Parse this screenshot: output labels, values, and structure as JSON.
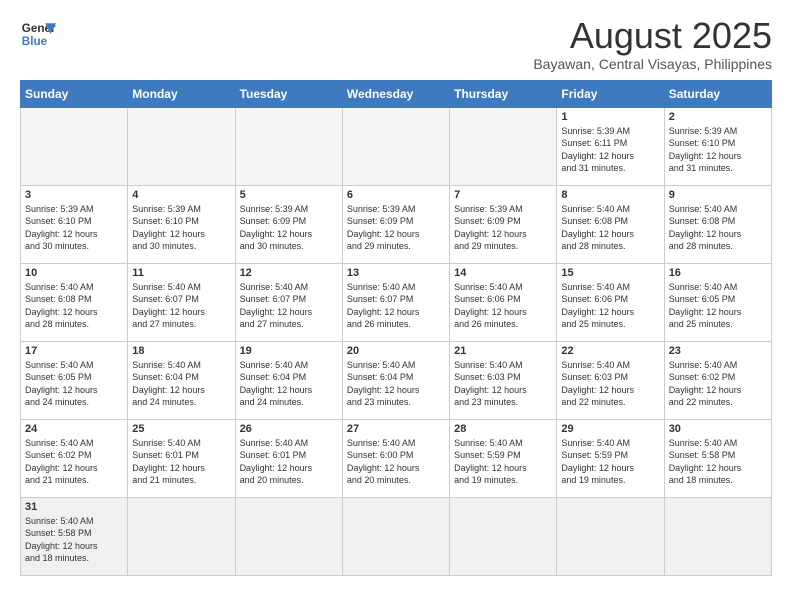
{
  "header": {
    "logo_general": "General",
    "logo_blue": "Blue",
    "title": "August 2025",
    "subtitle": "Bayawan, Central Visayas, Philippines"
  },
  "weekdays": [
    "Sunday",
    "Monday",
    "Tuesday",
    "Wednesday",
    "Thursday",
    "Friday",
    "Saturday"
  ],
  "weeks": [
    [
      {
        "day": "",
        "info": ""
      },
      {
        "day": "",
        "info": ""
      },
      {
        "day": "",
        "info": ""
      },
      {
        "day": "",
        "info": ""
      },
      {
        "day": "",
        "info": ""
      },
      {
        "day": "1",
        "info": "Sunrise: 5:39 AM\nSunset: 6:11 PM\nDaylight: 12 hours\nand 31 minutes."
      },
      {
        "day": "2",
        "info": "Sunrise: 5:39 AM\nSunset: 6:10 PM\nDaylight: 12 hours\nand 31 minutes."
      }
    ],
    [
      {
        "day": "3",
        "info": "Sunrise: 5:39 AM\nSunset: 6:10 PM\nDaylight: 12 hours\nand 30 minutes."
      },
      {
        "day": "4",
        "info": "Sunrise: 5:39 AM\nSunset: 6:10 PM\nDaylight: 12 hours\nand 30 minutes."
      },
      {
        "day": "5",
        "info": "Sunrise: 5:39 AM\nSunset: 6:09 PM\nDaylight: 12 hours\nand 30 minutes."
      },
      {
        "day": "6",
        "info": "Sunrise: 5:39 AM\nSunset: 6:09 PM\nDaylight: 12 hours\nand 29 minutes."
      },
      {
        "day": "7",
        "info": "Sunrise: 5:39 AM\nSunset: 6:09 PM\nDaylight: 12 hours\nand 29 minutes."
      },
      {
        "day": "8",
        "info": "Sunrise: 5:40 AM\nSunset: 6:08 PM\nDaylight: 12 hours\nand 28 minutes."
      },
      {
        "day": "9",
        "info": "Sunrise: 5:40 AM\nSunset: 6:08 PM\nDaylight: 12 hours\nand 28 minutes."
      }
    ],
    [
      {
        "day": "10",
        "info": "Sunrise: 5:40 AM\nSunset: 6:08 PM\nDaylight: 12 hours\nand 28 minutes."
      },
      {
        "day": "11",
        "info": "Sunrise: 5:40 AM\nSunset: 6:07 PM\nDaylight: 12 hours\nand 27 minutes."
      },
      {
        "day": "12",
        "info": "Sunrise: 5:40 AM\nSunset: 6:07 PM\nDaylight: 12 hours\nand 27 minutes."
      },
      {
        "day": "13",
        "info": "Sunrise: 5:40 AM\nSunset: 6:07 PM\nDaylight: 12 hours\nand 26 minutes."
      },
      {
        "day": "14",
        "info": "Sunrise: 5:40 AM\nSunset: 6:06 PM\nDaylight: 12 hours\nand 26 minutes."
      },
      {
        "day": "15",
        "info": "Sunrise: 5:40 AM\nSunset: 6:06 PM\nDaylight: 12 hours\nand 25 minutes."
      },
      {
        "day": "16",
        "info": "Sunrise: 5:40 AM\nSunset: 6:05 PM\nDaylight: 12 hours\nand 25 minutes."
      }
    ],
    [
      {
        "day": "17",
        "info": "Sunrise: 5:40 AM\nSunset: 6:05 PM\nDaylight: 12 hours\nand 24 minutes."
      },
      {
        "day": "18",
        "info": "Sunrise: 5:40 AM\nSunset: 6:04 PM\nDaylight: 12 hours\nand 24 minutes."
      },
      {
        "day": "19",
        "info": "Sunrise: 5:40 AM\nSunset: 6:04 PM\nDaylight: 12 hours\nand 24 minutes."
      },
      {
        "day": "20",
        "info": "Sunrise: 5:40 AM\nSunset: 6:04 PM\nDaylight: 12 hours\nand 23 minutes."
      },
      {
        "day": "21",
        "info": "Sunrise: 5:40 AM\nSunset: 6:03 PM\nDaylight: 12 hours\nand 23 minutes."
      },
      {
        "day": "22",
        "info": "Sunrise: 5:40 AM\nSunset: 6:03 PM\nDaylight: 12 hours\nand 22 minutes."
      },
      {
        "day": "23",
        "info": "Sunrise: 5:40 AM\nSunset: 6:02 PM\nDaylight: 12 hours\nand 22 minutes."
      }
    ],
    [
      {
        "day": "24",
        "info": "Sunrise: 5:40 AM\nSunset: 6:02 PM\nDaylight: 12 hours\nand 21 minutes."
      },
      {
        "day": "25",
        "info": "Sunrise: 5:40 AM\nSunset: 6:01 PM\nDaylight: 12 hours\nand 21 minutes."
      },
      {
        "day": "26",
        "info": "Sunrise: 5:40 AM\nSunset: 6:01 PM\nDaylight: 12 hours\nand 20 minutes."
      },
      {
        "day": "27",
        "info": "Sunrise: 5:40 AM\nSunset: 6:00 PM\nDaylight: 12 hours\nand 20 minutes."
      },
      {
        "day": "28",
        "info": "Sunrise: 5:40 AM\nSunset: 5:59 PM\nDaylight: 12 hours\nand 19 minutes."
      },
      {
        "day": "29",
        "info": "Sunrise: 5:40 AM\nSunset: 5:59 PM\nDaylight: 12 hours\nand 19 minutes."
      },
      {
        "day": "30",
        "info": "Sunrise: 5:40 AM\nSunset: 5:58 PM\nDaylight: 12 hours\nand 18 minutes."
      }
    ],
    [
      {
        "day": "31",
        "info": "Sunrise: 5:40 AM\nSunset: 5:58 PM\nDaylight: 12 hours\nand 18 minutes."
      },
      {
        "day": "",
        "info": ""
      },
      {
        "day": "",
        "info": ""
      },
      {
        "day": "",
        "info": ""
      },
      {
        "day": "",
        "info": ""
      },
      {
        "day": "",
        "info": ""
      },
      {
        "day": "",
        "info": ""
      }
    ]
  ]
}
